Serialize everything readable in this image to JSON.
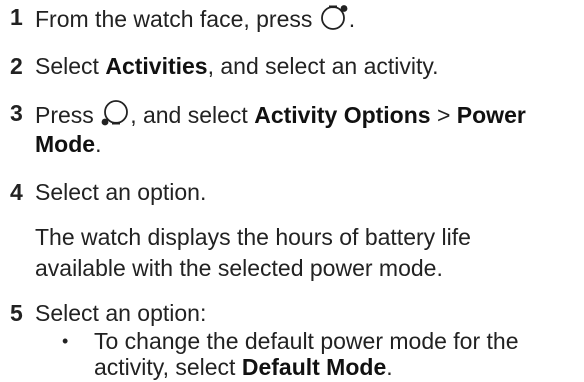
{
  "steps": [
    {
      "number": "1",
      "text_before": "From the watch face, press",
      "text_after": "."
    },
    {
      "number": "2",
      "text_select": "Select",
      "activities": "Activities",
      "text_after": ", and select an activity."
    },
    {
      "number": "3",
      "text_press": "Press",
      "text_and_select": ", and select",
      "activity_options": "Activity Options",
      "separator": ">",
      "power": "Power",
      "mode": "Mode",
      "period": "."
    },
    {
      "number": "4",
      "text": "Select an option.",
      "note_line1": "The watch displays the hours of battery life",
      "note_line2": "available with the selected power mode."
    },
    {
      "number": "5",
      "text": "Select an option:",
      "bullet": "•",
      "sub_line1": "To change the default power mode for the",
      "sub_line2_before": "activity, select",
      "default_mode": "Default Mode",
      "sub_line2_after": "."
    }
  ],
  "icons": {
    "step1": "watch-button-top-right-icon",
    "step3": "watch-button-bottom-left-icon"
  }
}
